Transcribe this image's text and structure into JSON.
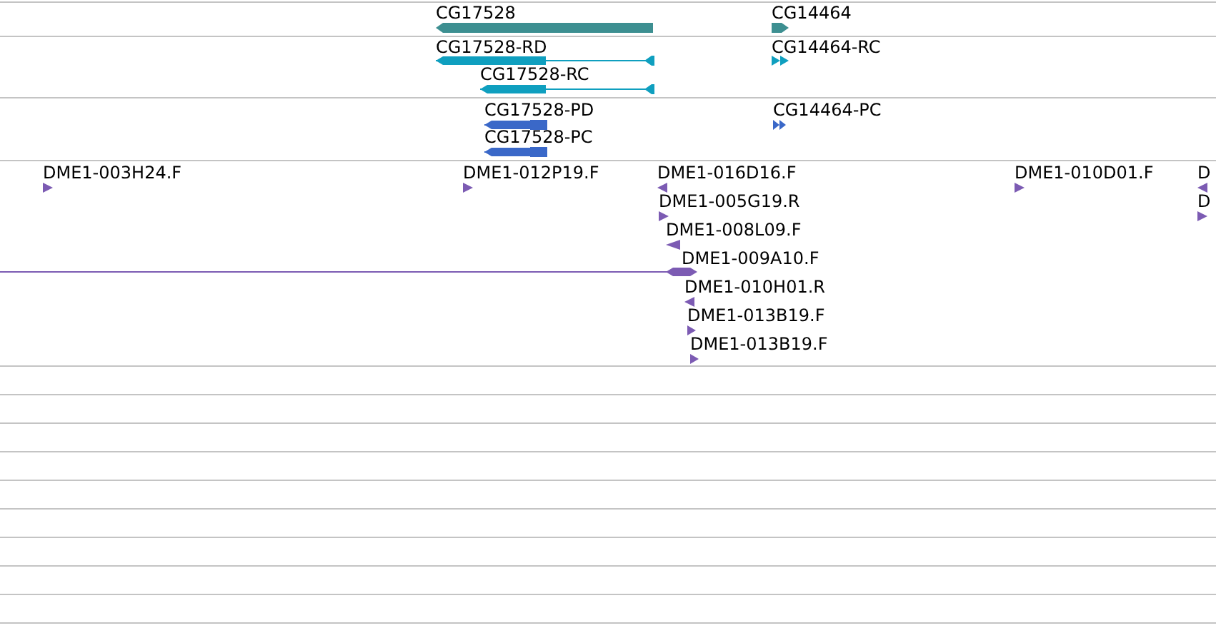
{
  "tracks": [
    {
      "color": "#3d8f91",
      "features": [
        {
          "label": "CG17528",
          "reverse": true
        },
        {
          "label": "CG14464",
          "reverse": false
        }
      ]
    },
    {
      "color": "#0f9fbf",
      "features": [
        {
          "label": "CG17528-RD",
          "reverse": true
        },
        {
          "label": "CG17528-RC",
          "reverse": true
        },
        {
          "label": "CG14464-RC",
          "reverse": false
        }
      ]
    },
    {
      "color": "#3a68c8",
      "features": [
        {
          "label": "CG17528-PD",
          "reverse": true
        },
        {
          "label": "CG17528-PC",
          "reverse": true
        },
        {
          "label": "CG14464-PC",
          "reverse": false
        }
      ]
    },
    {
      "color": "#7c5bb3",
      "features": [
        {
          "label": "DME1-003H24.F",
          "reverse": false
        },
        {
          "label": "DME1-012P19.F",
          "reverse": false
        },
        {
          "label": "DME1-016D16.F",
          "reverse": true
        },
        {
          "label": "DME1-005G19.R",
          "reverse": false
        },
        {
          "label": "DME1-008L09.F",
          "reverse": true
        },
        {
          "label": "DME1-009A10.F",
          "reverse": false
        },
        {
          "label": "DME1-010H01.R",
          "reverse": true
        },
        {
          "label": "DME1-013B19.F",
          "reverse": false
        },
        {
          "label": "DME1-013B19.F",
          "reverse": false
        },
        {
          "label": "DME1-010D01.F",
          "reverse": false
        },
        {
          "label": "D",
          "reverse": true
        },
        {
          "label": "D",
          "reverse": false
        }
      ]
    }
  ]
}
